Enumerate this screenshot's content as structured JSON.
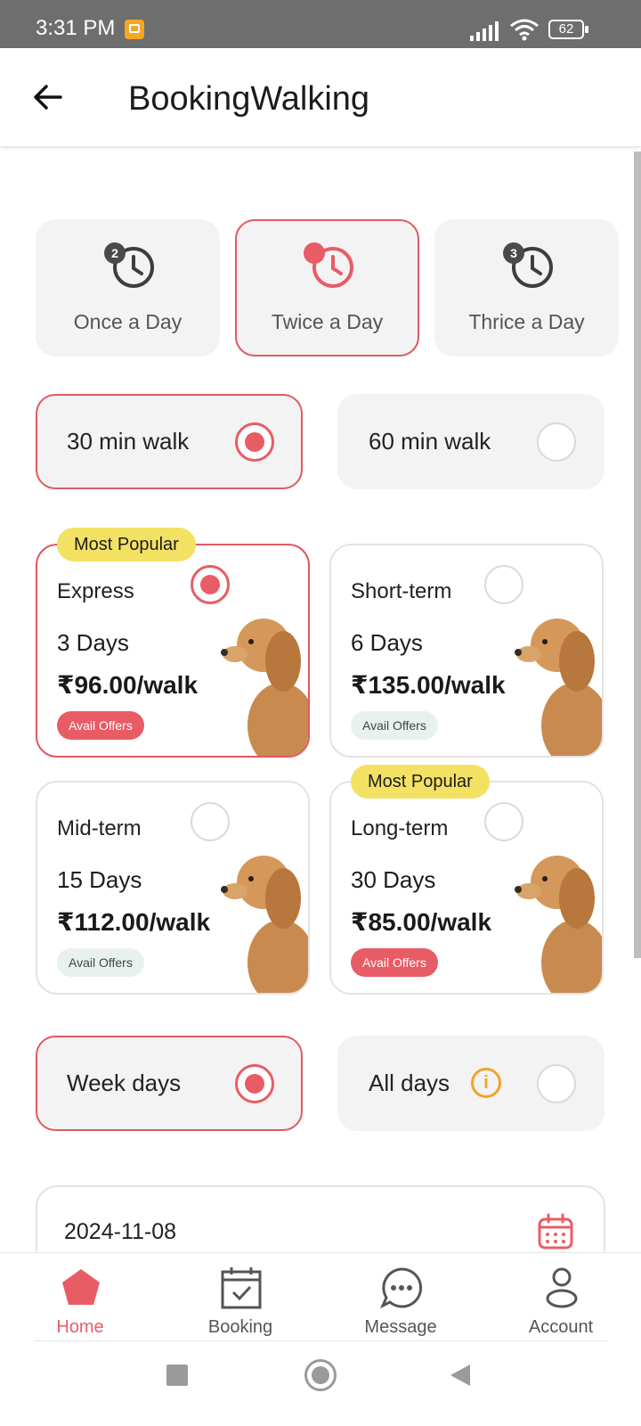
{
  "status_bar": {
    "time": "3:31 PM",
    "battery": "62"
  },
  "app_bar": {
    "title": "BookingWalking"
  },
  "frequency_options": [
    {
      "label": "Once a Day",
      "badge": "2",
      "selected": false
    },
    {
      "label": "Twice a Day",
      "badge": "",
      "selected": true
    },
    {
      "label": "Thrice a Day",
      "badge": "3",
      "selected": false
    }
  ],
  "walk_durations": [
    {
      "label": "30 min walk",
      "selected": true
    },
    {
      "label": "60 min walk",
      "selected": false
    }
  ],
  "plans": [
    {
      "name": "Express",
      "days": "3 Days",
      "price": "₹96.00/walk",
      "offer": "Avail Offers",
      "badge": "Most Popular",
      "selected": true
    },
    {
      "name": "Short-term",
      "days": "6 Days",
      "price": "₹135.00/walk",
      "offer": "Avail Offers",
      "badge": "",
      "selected": false
    },
    {
      "name": "Mid-term",
      "days": "15 Days",
      "price": "₹112.00/walk",
      "offer": "Avail Offers",
      "badge": "",
      "selected": false
    },
    {
      "name": "Long-term",
      "days": "30 Days",
      "price": "₹85.00/walk",
      "offer": "Avail Offers",
      "badge": "Most Popular",
      "selected": false
    }
  ],
  "day_options": [
    {
      "label": "Week days",
      "selected": true
    },
    {
      "label": "All days",
      "selected": false,
      "info_icon": "i"
    }
  ],
  "date_field": {
    "value": "2024-11-08",
    "icon": "calendar-icon"
  },
  "bottom_nav": [
    {
      "label": "Home",
      "icon": "home-icon",
      "active": true
    },
    {
      "label": "Booking",
      "icon": "booking-icon",
      "active": false
    },
    {
      "label": "Message",
      "icon": "message-icon",
      "active": false
    },
    {
      "label": "Account",
      "icon": "account-icon",
      "active": false
    }
  ],
  "colors": {
    "accent": "#e85c66",
    "popular_badge": "#f3e163",
    "card_bg": "#f3f3f3",
    "offer_bg": "#e8f1ee",
    "info": "#f2a32b"
  }
}
